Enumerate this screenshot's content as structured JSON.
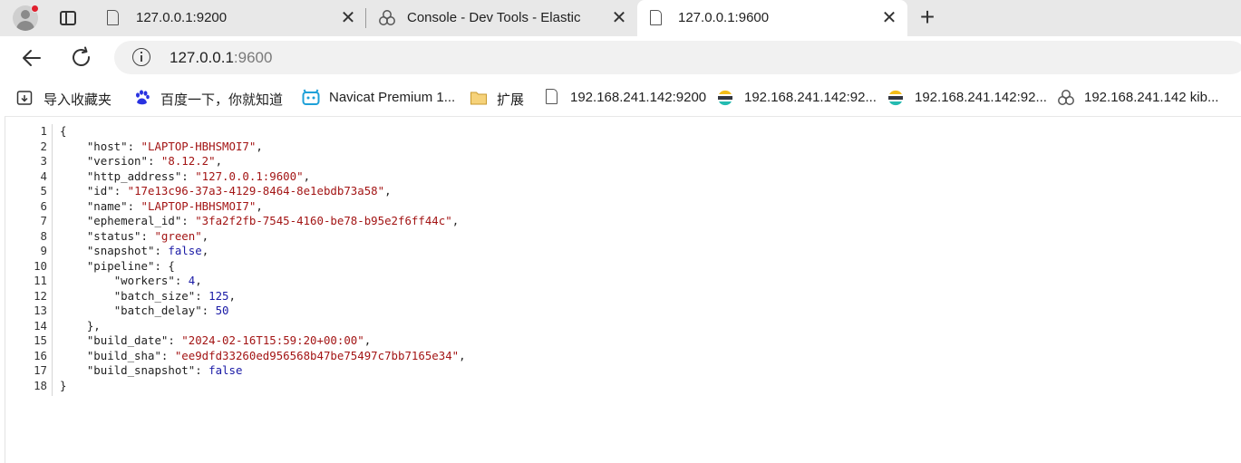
{
  "tabs": [
    {
      "title": "127.0.0.1:9200",
      "icon": "document-icon",
      "active": false
    },
    {
      "title": "Console - Dev Tools - Elastic",
      "icon": "elastic-icon",
      "active": false
    },
    {
      "title": "127.0.0.1:9600",
      "icon": "document-icon",
      "active": true
    }
  ],
  "new_tab_label": "+",
  "close_glyph": "✕",
  "address": {
    "host": "127.0.0.1",
    "port": ":9600"
  },
  "bookmarks": [
    {
      "label": "导入收藏夹",
      "icon": "import-icon"
    },
    {
      "label": "百度一下，你就知道",
      "icon": "baidu-paw-icon"
    },
    {
      "label": "Navicat Premium 1...",
      "icon": "navicat-icon"
    },
    {
      "label": "扩展",
      "icon": "folder-icon"
    },
    {
      "label": "192.168.241.142:9200",
      "icon": "document-icon"
    },
    {
      "label": "192.168.241.142:92...",
      "icon": "elastic-icon"
    },
    {
      "label": "192.168.241.142:92...",
      "icon": "elastic-icon"
    },
    {
      "label": "192.168.241.142 kib...",
      "icon": "kibana-icon"
    }
  ],
  "json_lines": [
    {
      "n": "1",
      "segs": [
        [
          "p",
          "{"
        ]
      ]
    },
    {
      "n": "2",
      "segs": [
        [
          "p",
          "    "
        ],
        [
          "k",
          "\"host\""
        ],
        [
          "p",
          ": "
        ],
        [
          "s",
          "\"LAPTOP-HBHSMOI7\""
        ],
        [
          "p",
          ","
        ]
      ]
    },
    {
      "n": "3",
      "segs": [
        [
          "p",
          "    "
        ],
        [
          "k",
          "\"version\""
        ],
        [
          "p",
          ": "
        ],
        [
          "s",
          "\"8.12.2\""
        ],
        [
          "p",
          ","
        ]
      ]
    },
    {
      "n": "4",
      "segs": [
        [
          "p",
          "    "
        ],
        [
          "k",
          "\"http_address\""
        ],
        [
          "p",
          ": "
        ],
        [
          "s",
          "\"127.0.0.1:9600\""
        ],
        [
          "p",
          ","
        ]
      ]
    },
    {
      "n": "5",
      "segs": [
        [
          "p",
          "    "
        ],
        [
          "k",
          "\"id\""
        ],
        [
          "p",
          ": "
        ],
        [
          "s",
          "\"17e13c96-37a3-4129-8464-8e1ebdb73a58\""
        ],
        [
          "p",
          ","
        ]
      ]
    },
    {
      "n": "6",
      "segs": [
        [
          "p",
          "    "
        ],
        [
          "k",
          "\"name\""
        ],
        [
          "p",
          ": "
        ],
        [
          "s",
          "\"LAPTOP-HBHSMOI7\""
        ],
        [
          "p",
          ","
        ]
      ]
    },
    {
      "n": "7",
      "segs": [
        [
          "p",
          "    "
        ],
        [
          "k",
          "\"ephemeral_id\""
        ],
        [
          "p",
          ": "
        ],
        [
          "s",
          "\"3fa2f2fb-7545-4160-be78-b95e2f6ff44c\""
        ],
        [
          "p",
          ","
        ]
      ]
    },
    {
      "n": "8",
      "segs": [
        [
          "p",
          "    "
        ],
        [
          "k",
          "\"status\""
        ],
        [
          "p",
          ": "
        ],
        [
          "s",
          "\"green\""
        ],
        [
          "p",
          ","
        ]
      ]
    },
    {
      "n": "9",
      "segs": [
        [
          "p",
          "    "
        ],
        [
          "k",
          "\"snapshot\""
        ],
        [
          "p",
          ": "
        ],
        [
          "b",
          "false"
        ],
        [
          "p",
          ","
        ]
      ]
    },
    {
      "n": "10",
      "segs": [
        [
          "p",
          "    "
        ],
        [
          "k",
          "\"pipeline\""
        ],
        [
          "p",
          ": {"
        ]
      ]
    },
    {
      "n": "11",
      "segs": [
        [
          "p",
          "        "
        ],
        [
          "k",
          "\"workers\""
        ],
        [
          "p",
          ": "
        ],
        [
          "n",
          "4"
        ],
        [
          "p",
          ","
        ]
      ]
    },
    {
      "n": "12",
      "segs": [
        [
          "p",
          "        "
        ],
        [
          "k",
          "\"batch_size\""
        ],
        [
          "p",
          ": "
        ],
        [
          "n",
          "125"
        ],
        [
          "p",
          ","
        ]
      ]
    },
    {
      "n": "13",
      "segs": [
        [
          "p",
          "        "
        ],
        [
          "k",
          "\"batch_delay\""
        ],
        [
          "p",
          ": "
        ],
        [
          "n",
          "50"
        ]
      ]
    },
    {
      "n": "14",
      "segs": [
        [
          "p",
          "    },"
        ]
      ]
    },
    {
      "n": "15",
      "segs": [
        [
          "p",
          "    "
        ],
        [
          "k",
          "\"build_date\""
        ],
        [
          "p",
          ": "
        ],
        [
          "s",
          "\"2024-02-16T15:59:20+00:00\""
        ],
        [
          "p",
          ","
        ]
      ]
    },
    {
      "n": "16",
      "segs": [
        [
          "p",
          "    "
        ],
        [
          "k",
          "\"build_sha\""
        ],
        [
          "p",
          ": "
        ],
        [
          "s",
          "\"ee9dfd33260ed956568b47be75497c7bb7165e34\""
        ],
        [
          "p",
          ","
        ]
      ]
    },
    {
      "n": "17",
      "segs": [
        [
          "p",
          "    "
        ],
        [
          "k",
          "\"build_snapshot\""
        ],
        [
          "p",
          ": "
        ],
        [
          "b",
          "false"
        ]
      ]
    },
    {
      "n": "18",
      "segs": [
        [
          "p",
          "}"
        ]
      ]
    }
  ],
  "colors": {
    "string": "#a31515",
    "number": "#1a1aa6",
    "boolean": "#1a1aa6"
  }
}
